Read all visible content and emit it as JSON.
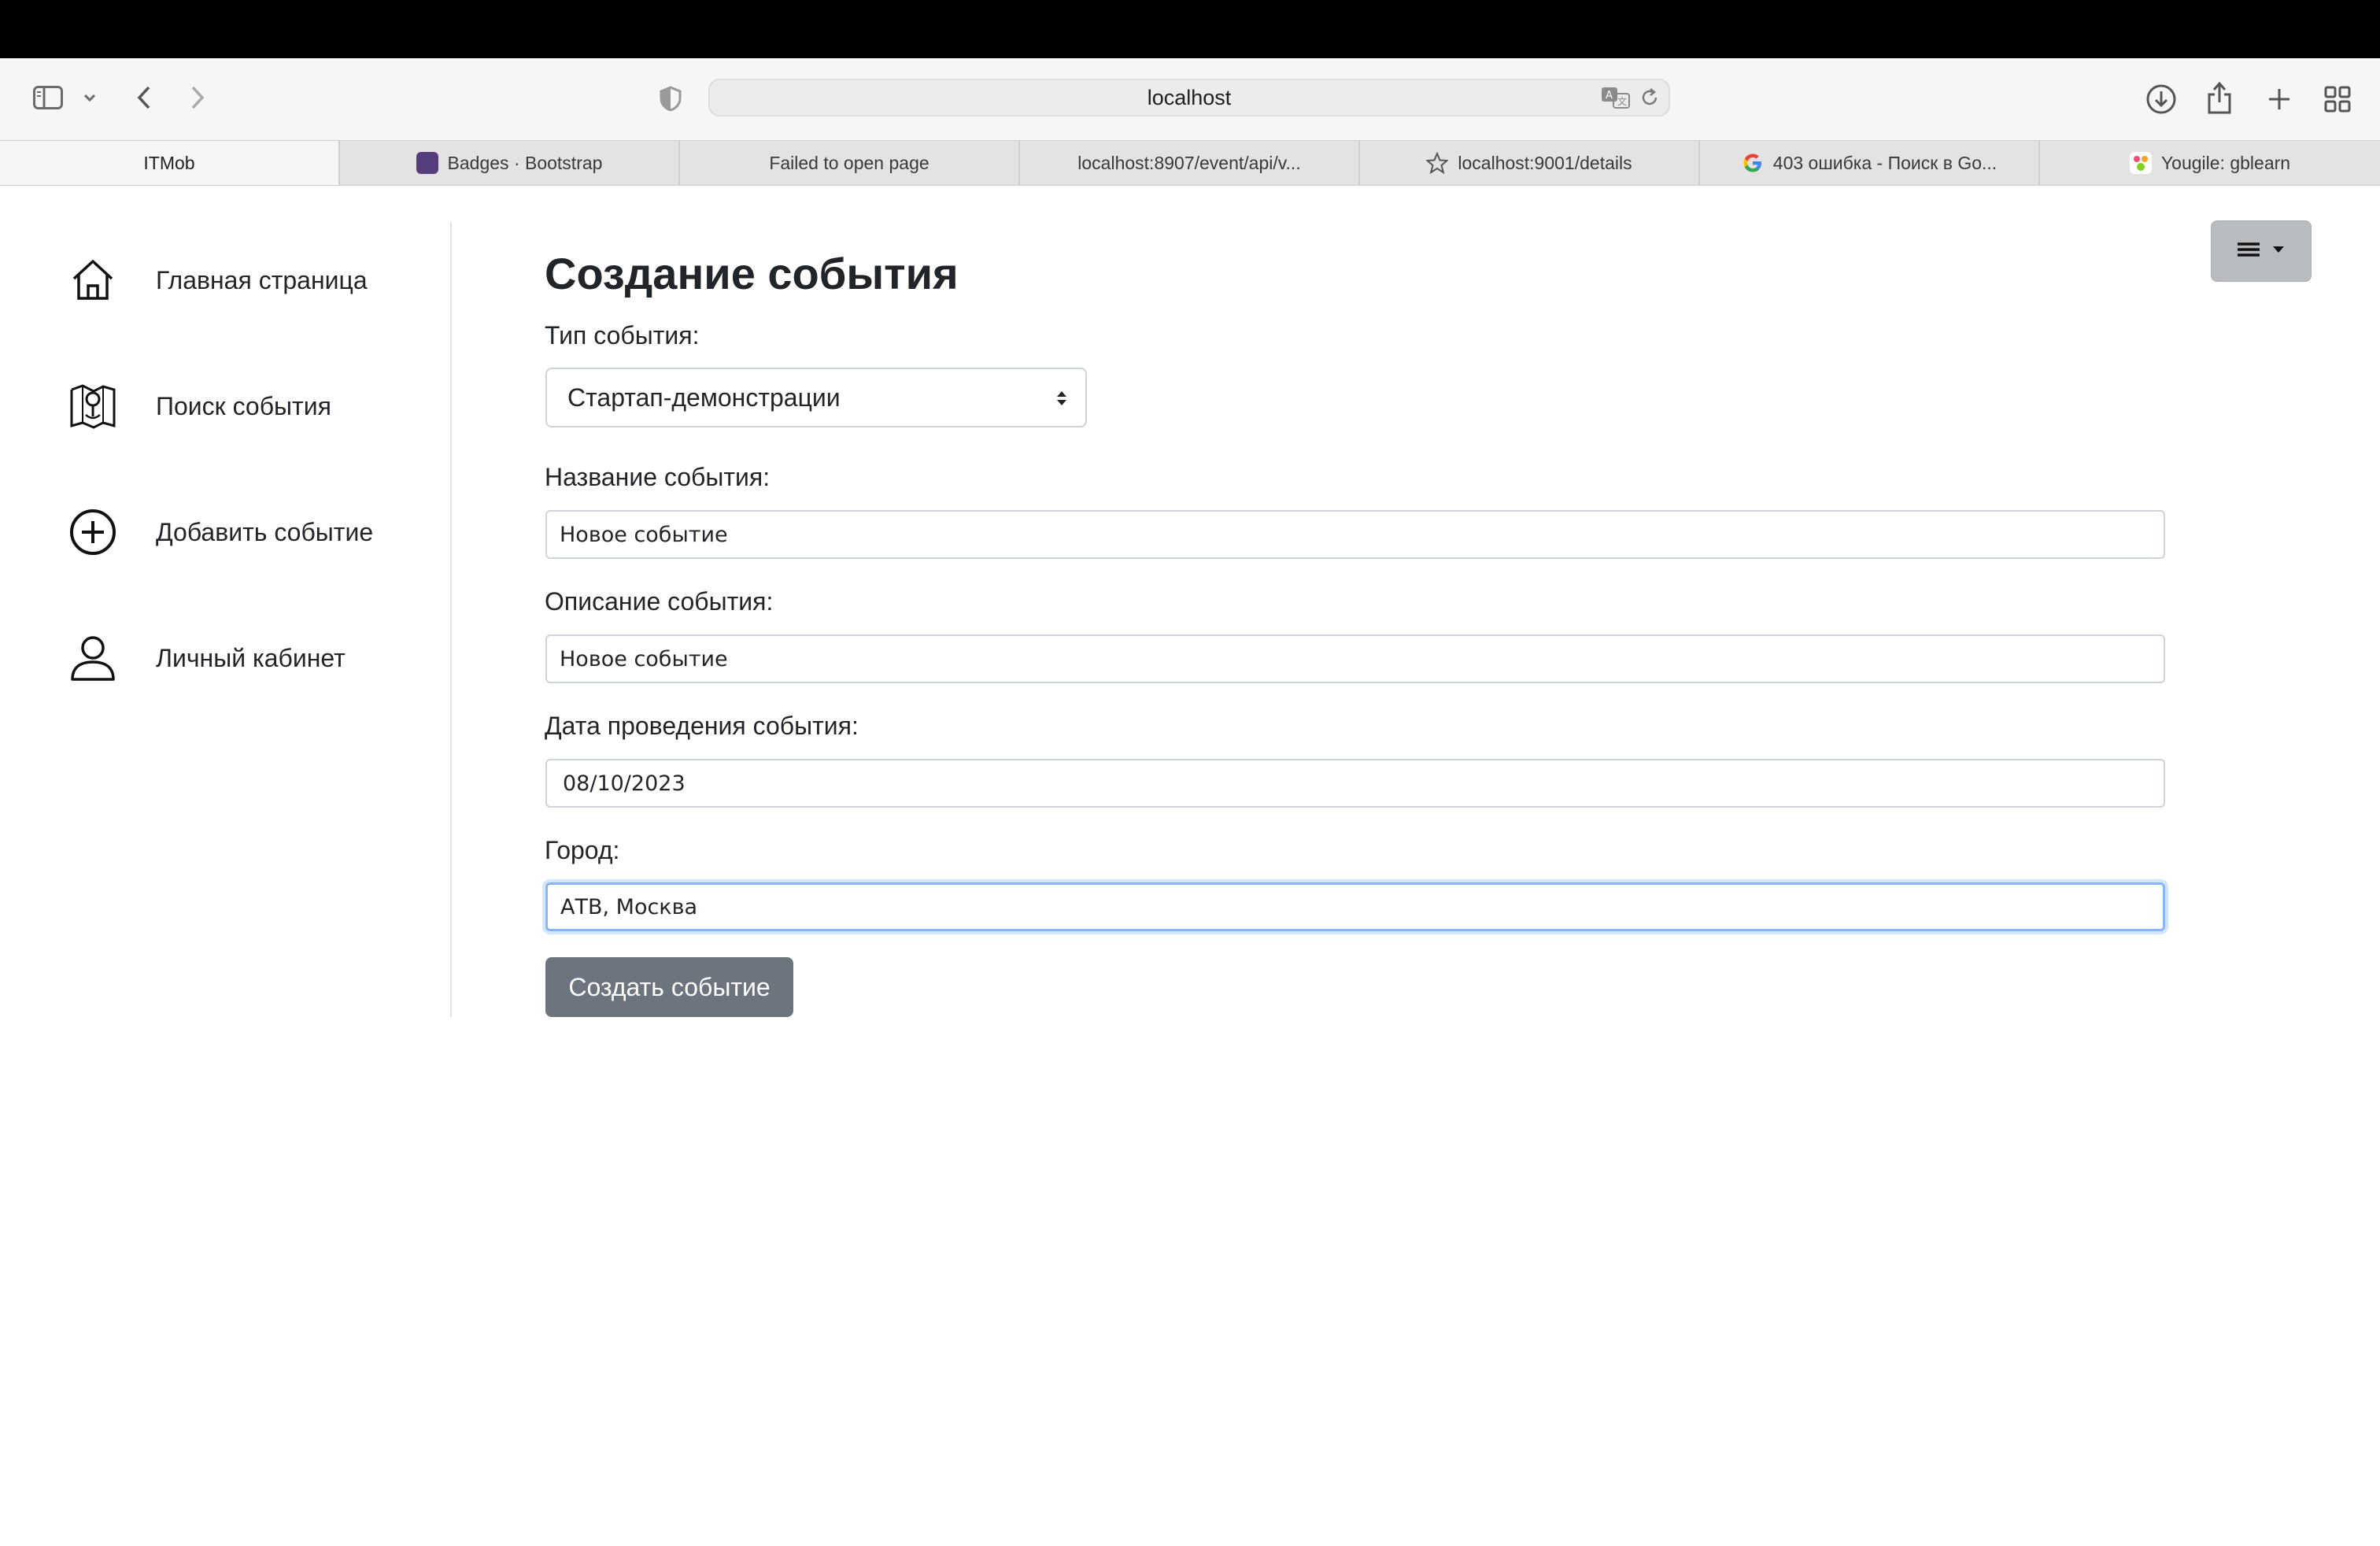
{
  "browser": {
    "url": "localhost",
    "tabs": [
      {
        "label": "ITMob",
        "active": true,
        "icon": "none"
      },
      {
        "label": "Badges · Bootstrap",
        "icon": "bootstrap-icon"
      },
      {
        "label": "Failed to open page",
        "icon": "none"
      },
      {
        "label": "localhost:8907/event/api/v...",
        "icon": "none"
      },
      {
        "label": "localhost:9001/details",
        "icon": "star-icon"
      },
      {
        "label": "403 ошибка - Поиск в Go...",
        "icon": "google-icon"
      },
      {
        "label": "Yougile: gblearn",
        "icon": "yougile-icon"
      }
    ]
  },
  "sidebar": {
    "items": [
      {
        "label": "Главная страница",
        "icon": "home-icon"
      },
      {
        "label": "Поиск события",
        "icon": "map-search-icon"
      },
      {
        "label": "Добавить событие",
        "icon": "plus-circle-icon"
      },
      {
        "label": "Личный кабинет",
        "icon": "user-icon"
      }
    ]
  },
  "form": {
    "title": "Создание события",
    "type_label": "Тип события:",
    "type_value": "Стартап-демонстрации",
    "name_label": "Название события:",
    "name_value": "Новое событие",
    "description_label": "Описание события:",
    "description_value": "Новое событие",
    "date_label": "Дата проведения события:",
    "date_value": "08/10/2023",
    "city_label": "Город:",
    "city_value": "АТВ, Москва",
    "submit_label": "Создать событие"
  },
  "colors": {
    "button_secondary": "#6c757d",
    "focus_border": "#86b7fe",
    "menu_button": "#b9bcbf"
  }
}
